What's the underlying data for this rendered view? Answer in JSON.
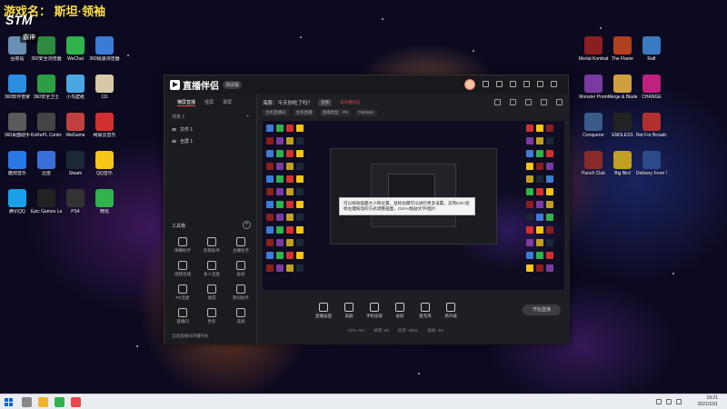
{
  "stream_overlay": {
    "title": "游戏名：  斯坦·领袖",
    "logo": "STM",
    "user": "霸神"
  },
  "desktop_icons_left": [
    {
      "label": "回收站",
      "color": "#6a8fb5"
    },
    {
      "label": "360安全浏览器",
      "color": "#2e8b3e"
    },
    {
      "label": "WeChat",
      "color": "#2fb34a"
    },
    {
      "label": "360极速浏览器",
      "color": "#3a7bd5"
    },
    {
      "label": "360软件管家",
      "color": "#2c8de0"
    },
    {
      "label": "360安全卫士",
      "color": "#2e9d46"
    },
    {
      "label": "小鸟壁纸",
      "color": "#4aa7e3"
    },
    {
      "label": "111",
      "color": "#d8c8a8"
    },
    {
      "label": "360桌面助手",
      "color": "#5a5a5a"
    },
    {
      "label": "KoRePL Control",
      "color": "#444"
    },
    {
      "label": "WeGame",
      "color": "#c04040"
    },
    {
      "label": "网易云音乐",
      "color": "#d23030"
    },
    {
      "label": "酷狗音乐",
      "color": "#2a78e4"
    },
    {
      "label": "迅雷",
      "color": "#3a6fd8"
    },
    {
      "label": "Steam",
      "color": "#1b2838"
    },
    {
      "label": "QQ音乐",
      "color": "#f5c518"
    },
    {
      "label": "腾讯QQ",
      "color": "#1a9fe8"
    },
    {
      "label": "Epic Games Launcher",
      "color": "#222"
    },
    {
      "label": "PS4",
      "color": "#333"
    },
    {
      "label": "微信",
      "color": "#2fb34a"
    }
  ],
  "desktop_icons_right": [
    {
      "label": "Mortal Kombat",
      "color": "#8a1f1f"
    },
    {
      "label": "The Flame",
      "color": "#b04020"
    },
    {
      "label": "Raft",
      "color": "#3a7ac0"
    },
    {
      "label": "Monster Prom",
      "color": "#7a3aa0"
    },
    {
      "label": "Merge & Blade",
      "color": "#d0a040"
    },
    {
      "label": "CHANGE",
      "color": "#c02080"
    },
    {
      "label": "Conqueror",
      "color": "#3a5a8a"
    },
    {
      "label": "ENDLESS",
      "color": "#222"
    },
    {
      "label": "Not For Broadcast",
      "color": "#b03030"
    },
    {
      "label": "Punch Club",
      "color": "#8a2a2a"
    },
    {
      "label": "Big Bird",
      "color": "#c0a020"
    },
    {
      "label": "Delivery From The Light",
      "color": "#2a4a8a"
    }
  ],
  "app": {
    "name": "直播伴侣",
    "version": "测试版",
    "sidebar": {
      "tabs": [
        "横屏直播",
        "竖屏",
        "录屏"
      ],
      "scene_header": "场景 1",
      "scenes": [
        "文件 1",
        "全屏 1"
      ],
      "tools_header": "工具箱",
      "tools": [
        "弹幕助手",
        "房管助手",
        "主播任务",
        "视频连线",
        "多人连麦",
        "投屏",
        "PK连麦",
        "福袋",
        "歌词助手",
        "直播间",
        "更多",
        "道具"
      ],
      "footer": "当前直播间开播时长"
    },
    "header": {
      "title": "海豚：今天你吃了吗？",
      "tag": "直播",
      "status": "未开播状态",
      "info": [
        "主机直播间",
        "主机直播",
        "直播类型：PK",
        "7540661"
      ]
    },
    "tooltip": "可以拖动画面大小和位置，鼠标右键可以进行更多设置，支持Ctrl+鼠标左键拖动的方式调整画面，Ctrl+V粘贴文字/图片",
    "controls": [
      "直播画面",
      "美颜",
      "手机投屏",
      "录屏",
      "麦克风",
      "扬声器"
    ],
    "go_live": "开始直播",
    "stats": [
      "CPU: 6%",
      "帧率: 60",
      "码率: 0kb/s",
      "丢帧: 0%"
    ]
  },
  "taskbar": {
    "time": "19:21",
    "date": "2021/10/1"
  }
}
